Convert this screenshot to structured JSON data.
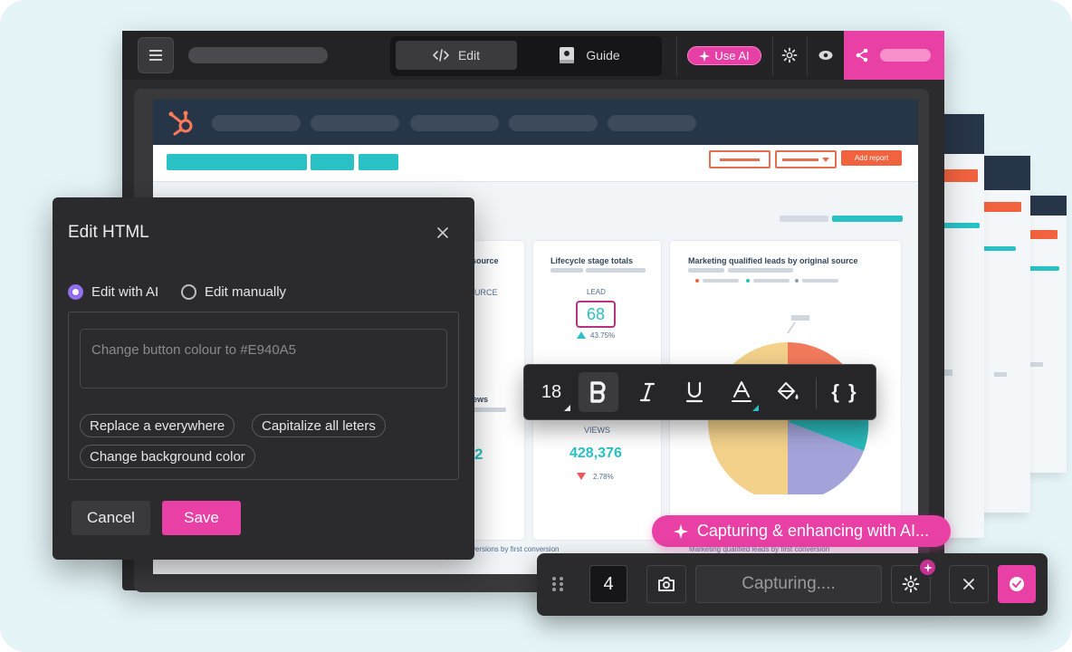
{
  "toolbar": {
    "edit_label": "Edit",
    "guide_label": "Guide",
    "use_ai_label": "Use AI"
  },
  "dashboard": {
    "add_report_label": "Add report",
    "cards": {
      "source_partial": "source",
      "source_sub_partial": "URCE",
      "lifecycle_title": "Lifecycle stage totals",
      "lifecycle_label": "LEAD",
      "lifecycle_value": "68",
      "lifecycle_change": "43.75%",
      "mql_title": "Marketing qualified leads by original source",
      "views_partial": "ews",
      "views_label": "VIEWS",
      "views_value": "428,376",
      "views_change": "2.78%",
      "views_left_value": "2",
      "footer_left": "versions by first conversion",
      "footer_right": "Marketing qualified leads by first conversion"
    }
  },
  "dialog": {
    "title": "Edit HTML",
    "option_ai": "Edit with AI",
    "option_manual": "Edit manually",
    "prompt_placeholder": "Change button colour to #E940A5",
    "suggestions": [
      "Replace a everywhere",
      "Capitalize all leters",
      "Change background color"
    ],
    "cancel_label": "Cancel",
    "save_label": "Save"
  },
  "format_toolbar": {
    "font_size": "18",
    "code_label": "{ }"
  },
  "capture": {
    "banner": "Capturing & enhancing with AI...",
    "count": "4",
    "status": "Capturing...."
  },
  "colors": {
    "accent": "#E940A5",
    "teal": "#29C1C4",
    "hubspot_orange": "#F1623E",
    "navy": "#273548"
  }
}
